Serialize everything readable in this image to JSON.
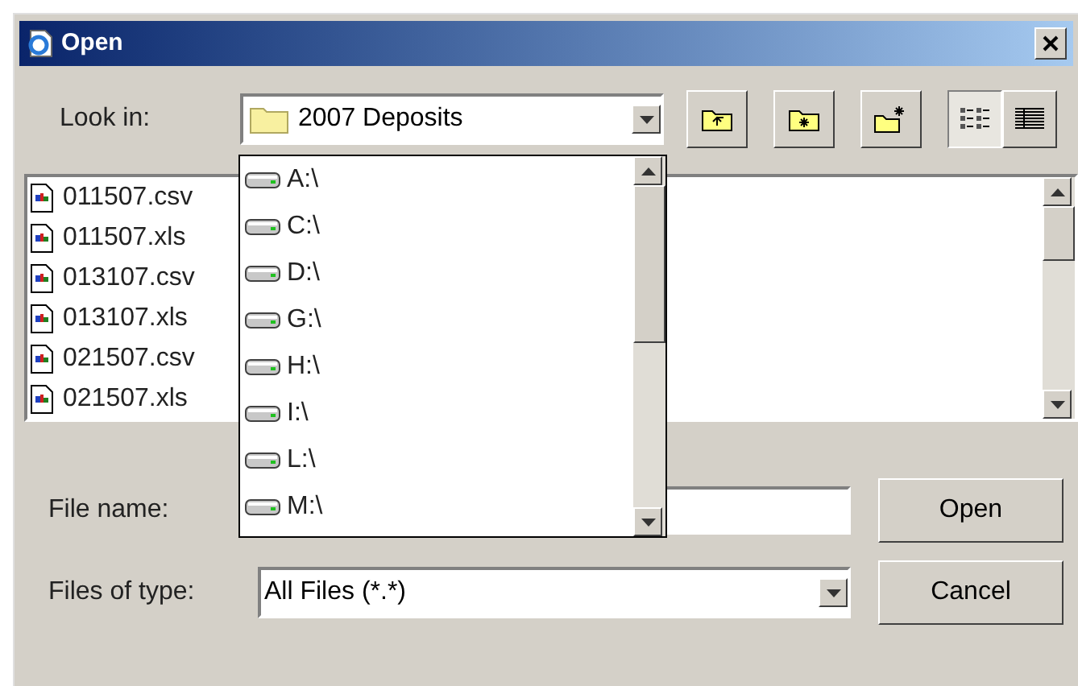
{
  "window": {
    "title": "Open"
  },
  "look_in": {
    "label": "Look in:",
    "value": "2007 Deposits"
  },
  "toolbar": [
    {
      "kind": "up"
    },
    {
      "kind": "home"
    },
    {
      "kind": "new"
    },
    {
      "kind": "list",
      "selected": true
    },
    {
      "kind": "details",
      "selected": false
    }
  ],
  "drives": [
    "A:\\",
    "C:\\",
    "D:\\",
    "G:\\",
    "H:\\",
    "I:\\",
    "L:\\",
    "M:\\"
  ],
  "files": [
    "011507.csv",
    "011507.xls",
    "013107.csv",
    "013107.xls",
    "021507.csv",
    "021507.xls"
  ],
  "file_name": {
    "label": "File name:"
  },
  "file_type": {
    "label": "Files of type:",
    "value": "All Files (*.*)"
  },
  "buttons": [
    "Open",
    "Cancel"
  ]
}
